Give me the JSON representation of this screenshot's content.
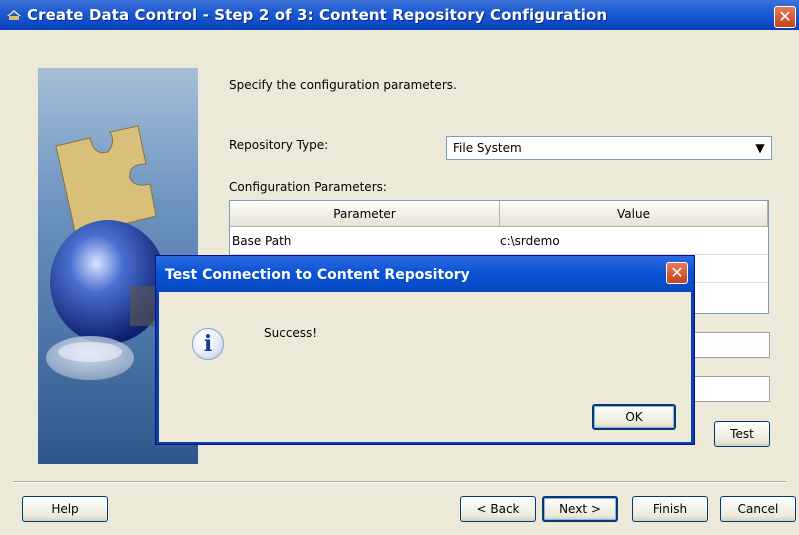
{
  "window": {
    "title": "Create Data Control - Step 2 of 3: Content Repository Configuration"
  },
  "form": {
    "instruction": "Specify the configuration parameters.",
    "repository_type_label": "Repository Type:",
    "repository_type_value": "File System",
    "config_params_label": "Configuration Parameters:",
    "table": {
      "columns": [
        "Parameter",
        "Value"
      ],
      "rows": [
        {
          "parameter": "Base Path",
          "value": "c:\\srdemo"
        }
      ]
    },
    "test_button": "Test"
  },
  "footer": {
    "help": "Help",
    "back": "< Back",
    "next": "Next >",
    "finish": "Finish",
    "cancel": "Cancel"
  },
  "dialog": {
    "title": "Test Connection to Content Repository",
    "message": "Success!",
    "ok": "OK",
    "icon": "info-icon"
  },
  "colors": {
    "titlebar": "#0a49c4",
    "window_bg": "#ece9d8",
    "button_border": "#003c74"
  }
}
